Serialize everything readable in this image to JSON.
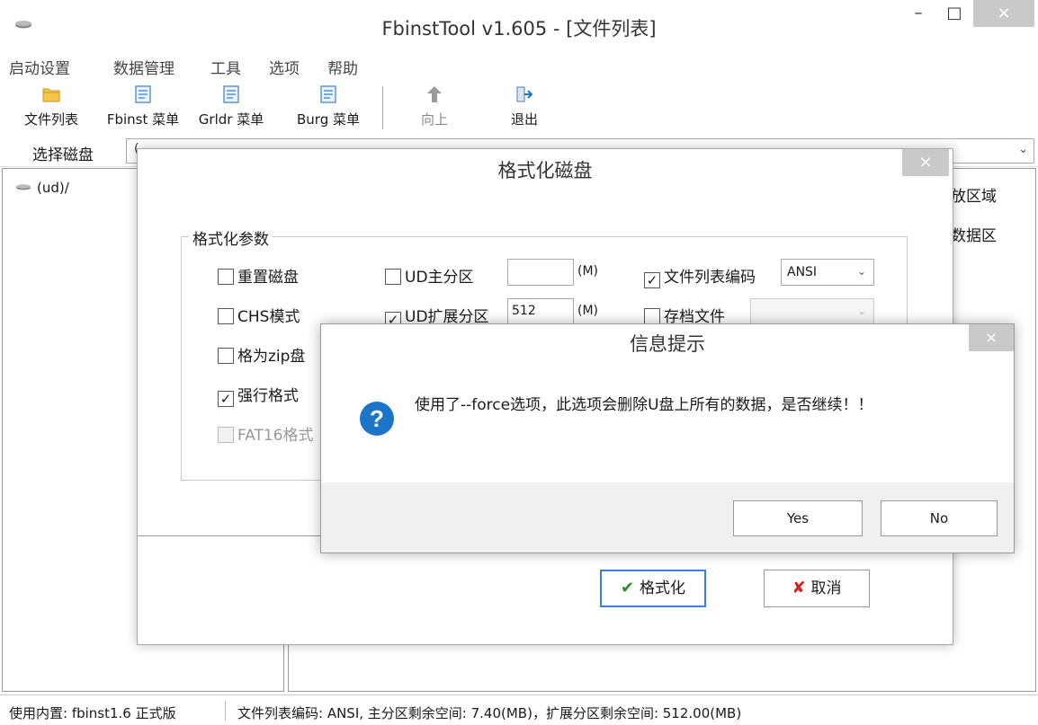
{
  "window": {
    "title": "FbinstTool v1.605 - [文件列表]",
    "min_label": "–",
    "max_label": "□",
    "close_label": "×",
    "icon": "drive-icon"
  },
  "menu": [
    "启动设置",
    "数据管理",
    "工具",
    "选项",
    "帮助"
  ],
  "toolbar": [
    {
      "label": "文件列表",
      "icon": "folder-icon"
    },
    {
      "label": "Fbinst 菜单",
      "icon": "menu-doc-icon"
    },
    {
      "label": "Grldr 菜单",
      "icon": "menu-doc-icon"
    },
    {
      "label": "Burg 菜单",
      "icon": "menu-doc-icon"
    },
    {
      "label": "向上",
      "icon": "up-icon",
      "disabled": true
    },
    {
      "label": "退出",
      "icon": "exit-icon"
    }
  ],
  "disk": {
    "label": "选择磁盘",
    "value": "(",
    "arrow": "⌄"
  },
  "tree": {
    "root": "(ud)/"
  },
  "right_pane": {
    "items": [
      "放区域",
      "数据区"
    ]
  },
  "status": {
    "left": "使用内置: fbinst1.6 正式版",
    "right": "文件列表编码: ANSI, 主分区剩余空间: 7.40(MB)，扩展分区剩余空间: 512.00(MB)"
  },
  "format_dialog": {
    "title": "格式化磁盘",
    "close_label": "×",
    "group_title": "格式化参数",
    "options": {
      "reset_disk": {
        "label": "重置磁盘",
        "checked": false
      },
      "chs_mode": {
        "label": "CHS模式",
        "checked": false
      },
      "zip_disk": {
        "label": "格为zip盘",
        "checked": false
      },
      "force_format": {
        "label": "强行格式",
        "checked": true
      },
      "fat16": {
        "label": "FAT16格式",
        "checked": false,
        "disabled": true
      },
      "ud_primary": {
        "label": "UD主分区",
        "checked": false,
        "value": "",
        "unit": "(M)"
      },
      "ud_extended": {
        "label": "UD扩展分区",
        "checked": true,
        "value": "512",
        "unit": "(M)"
      },
      "list_encoding": {
        "label": "文件列表编码",
        "checked": true,
        "value": "ANSI"
      },
      "archive_file": {
        "label": "存档文件",
        "checked": false,
        "value": ""
      }
    },
    "format_button": "格式化",
    "cancel_button": "取消",
    "check_mark": "✔",
    "cross_mark": "✘"
  },
  "message_box": {
    "title": "信息提示",
    "close_label": "×",
    "icon": "question-icon",
    "message": "使用了--force选项，此选项会删除U盘上所有的数据，是否继续！！",
    "yes_button": "Yes",
    "no_button": "No"
  },
  "colors": {
    "accent": "#1c76c8",
    "close_button": "#c9c9c9",
    "folder": "#f3c64a",
    "cancel_red": "#d32020",
    "check_green": "#2a8a2a"
  }
}
